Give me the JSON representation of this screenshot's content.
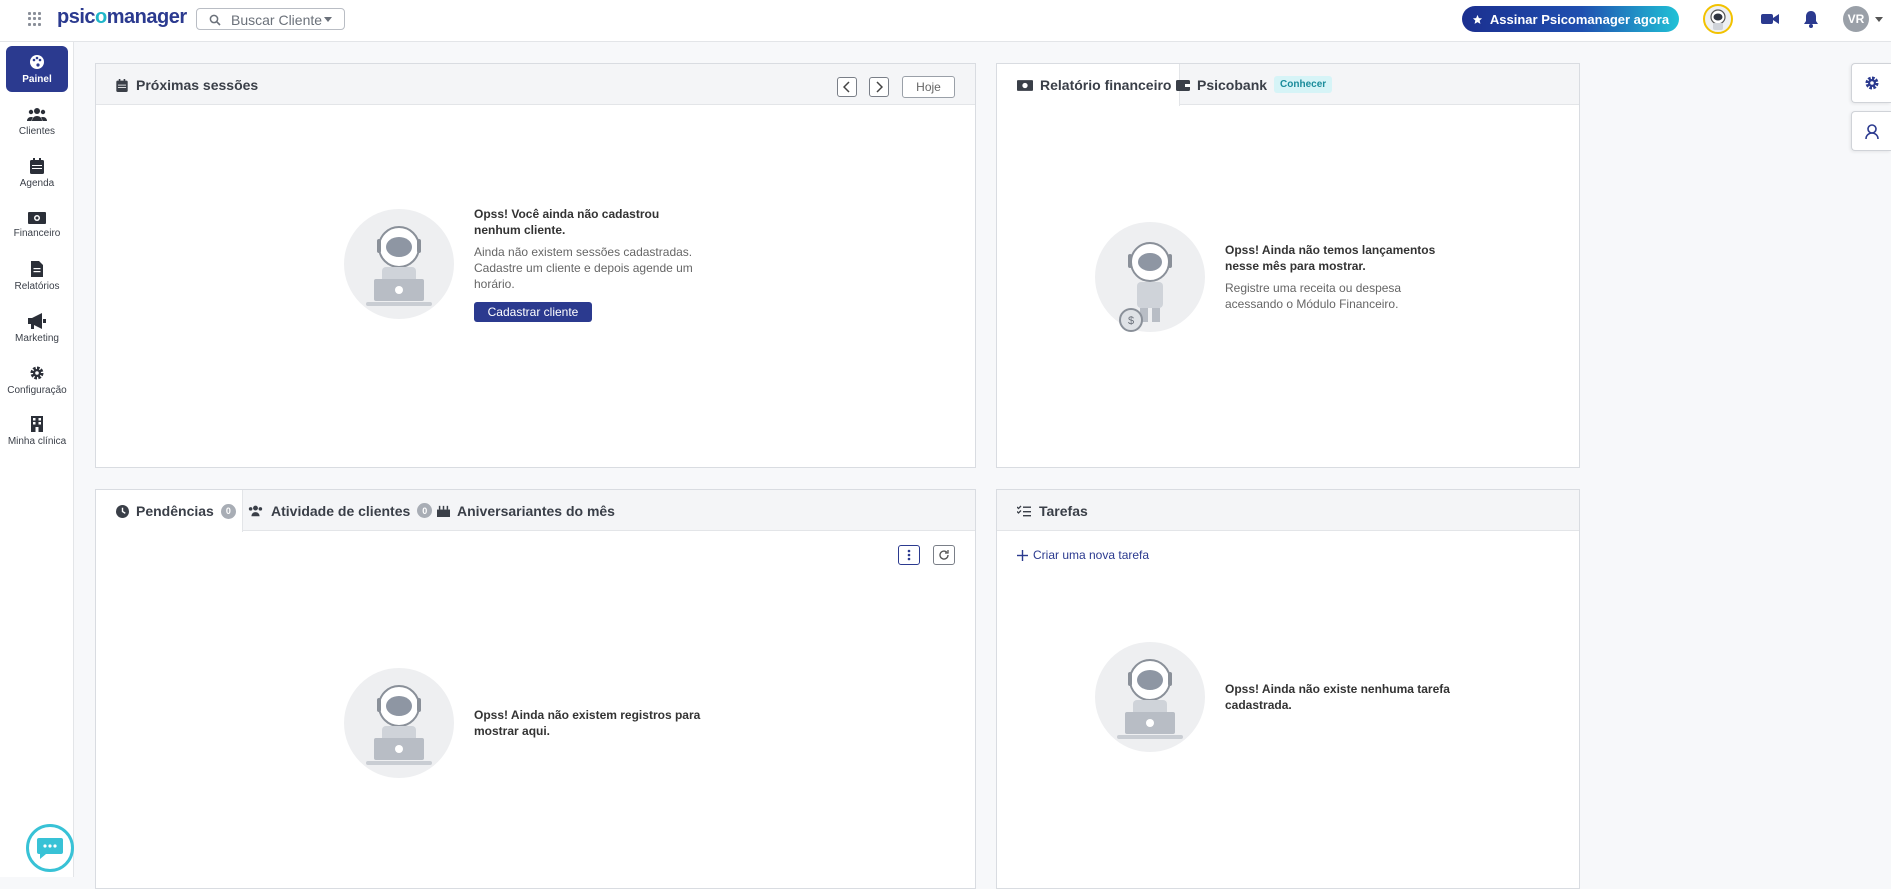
{
  "app": {
    "logo_main": "psicomanager",
    "logo_accent": "o",
    "brand_color": "#2b3a8f",
    "accent_color": "#20b6c9"
  },
  "header": {
    "search_placeholder": "Buscar Cliente",
    "subscribe_label": "Assinar Psicomanager agora",
    "user_initials": "VR",
    "icons": [
      "apps-grid-icon",
      "search-icon",
      "star-icon",
      "video-camera-icon",
      "bell-icon"
    ]
  },
  "sidebar": {
    "items": [
      {
        "label": "Painel",
        "icon": "palette-icon",
        "active": true
      },
      {
        "label": "Clientes",
        "icon": "users-icon"
      },
      {
        "label": "Agenda",
        "icon": "calendar-icon"
      },
      {
        "label": "Financeiro",
        "icon": "money-icon"
      },
      {
        "label": "Relatórios",
        "icon": "document-icon"
      },
      {
        "label": "Marketing",
        "icon": "megaphone-icon"
      },
      {
        "label": "Configuração",
        "icon": "gear-icon"
      },
      {
        "label": "Minha clínica",
        "icon": "building-icon"
      }
    ]
  },
  "sessions": {
    "title": "Próximas sessões",
    "today_label": "Hoje",
    "empty_title": "Opss! Você ainda não cadastrou nenhum cliente.",
    "empty_desc": "Ainda não existem sessões cadastradas. Cadastre um cliente e depois agende um horário.",
    "cta_label": "Cadastrar cliente"
  },
  "finance": {
    "tab_report": "Relatório financeiro",
    "tab_bank": "Psicobank",
    "bank_badge": "Conhecer",
    "empty_title": "Opss! Ainda não temos lançamentos nesse mês para mostrar.",
    "empty_desc": "Registre uma receita ou despesa acessando o Módulo Financeiro."
  },
  "activity": {
    "tab_pending": "Pendências",
    "pending_count": "0",
    "tab_clients": "Atividade de clientes",
    "clients_count": "0",
    "tab_birthdays": "Aniversariantes do mês",
    "empty_title": "Opss! Ainda não existem registros para mostrar aqui."
  },
  "tasks": {
    "title": "Tarefas",
    "add_label": "Criar uma nova tarefa",
    "empty_title": "Opss! Ainda não existe nenhuma tarefa cadastrada."
  }
}
